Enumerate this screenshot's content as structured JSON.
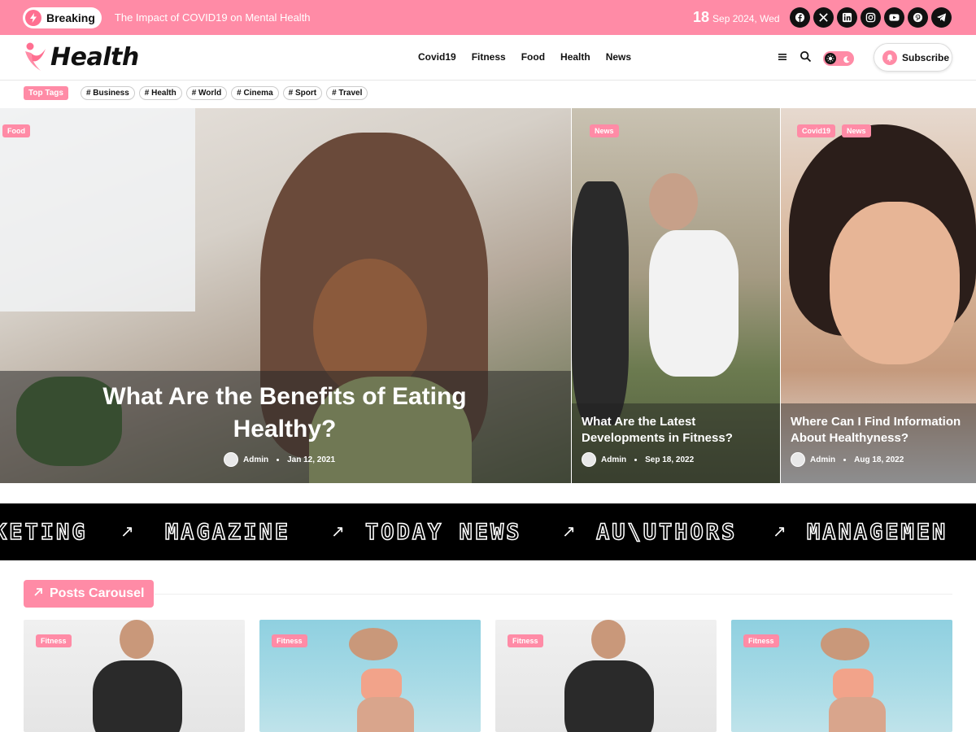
{
  "topbar": {
    "breaking_label": "Breaking",
    "breaking_text": "The Impact of COVID19 on Mental Health",
    "date_day": "18",
    "date_rest": "Sep 2024, Wed",
    "socials": [
      "facebook-icon",
      "x-icon",
      "linkedin-icon",
      "instagram-icon",
      "youtube-icon",
      "pinterest-icon",
      "telegram-icon"
    ]
  },
  "header": {
    "logo_text": "Health",
    "nav": [
      "Covid19",
      "Fitness",
      "Food",
      "Health",
      "News"
    ],
    "subscribe_label": "Subscribe"
  },
  "tags": {
    "heading": "Top Tags",
    "items": [
      "# Business",
      "# Health",
      "# World",
      "# Cinema",
      "# Sport",
      "# Travel"
    ]
  },
  "hero": {
    "main": {
      "category": "Food",
      "title": "What Are the Benefits of Eating Healthy?",
      "author": "Admin",
      "date": "Jan 12, 2021"
    },
    "side1": {
      "category": "News",
      "title_line1": "What Are the Latest",
      "title_line2": "Developments in Fitness?",
      "author": "Admin",
      "date": "Sep 18, 2022"
    },
    "side2": {
      "category1": "Covid19",
      "category2": "News",
      "title_line1": "Where Can I Find Information",
      "title_line2": "About Healthyness?",
      "author": "Admin",
      "date": "Aug 18, 2022"
    }
  },
  "marquee": {
    "items": [
      "KETING",
      "MAGAZINE",
      "TODAY NEWS",
      "AU\\UTHORS",
      "MANAGEMEN"
    ],
    "arrow": "↗"
  },
  "posts_carousel": {
    "heading": "Posts Carousel",
    "cards": [
      {
        "category": "Fitness"
      },
      {
        "category": "Fitness"
      },
      {
        "category": "Fitness"
      },
      {
        "category": "Fitness"
      }
    ]
  },
  "colors": {
    "accent": "#ff8ba6",
    "dark": "#111111"
  }
}
